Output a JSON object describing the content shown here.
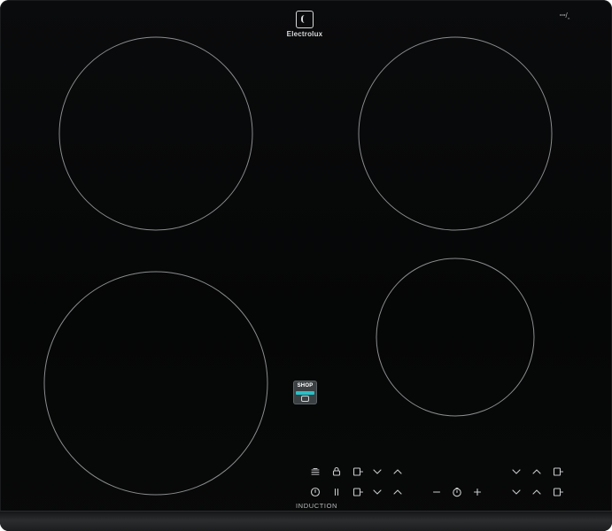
{
  "brand": {
    "logo_text": "Electrolux",
    "corner_mark": "ꟷ/ꞈ",
    "label": "INDUCTION"
  },
  "badge": {
    "text": "SHOP"
  },
  "controls": {
    "row1": [
      "bridge-icon",
      "lock-icon",
      "zone-select-icon",
      "chevron-down-icon",
      "chevron-up-icon",
      "chevron-down-icon",
      "chevron-up-icon",
      "zone-select-icon"
    ],
    "row2": [
      "power-icon",
      "pause-icon",
      "zone-select-icon",
      "chevron-down-icon",
      "chevron-up-icon",
      "minus-icon",
      "timer-icon",
      "plus-icon",
      "chevron-down-icon",
      "chevron-up-icon",
      "zone-select-icon"
    ]
  },
  "colors": {
    "surface": "#070808",
    "zone_outline": "#8a8c8e",
    "symbols": "#c7c9cb",
    "badge_accent": "#29c1c7"
  }
}
